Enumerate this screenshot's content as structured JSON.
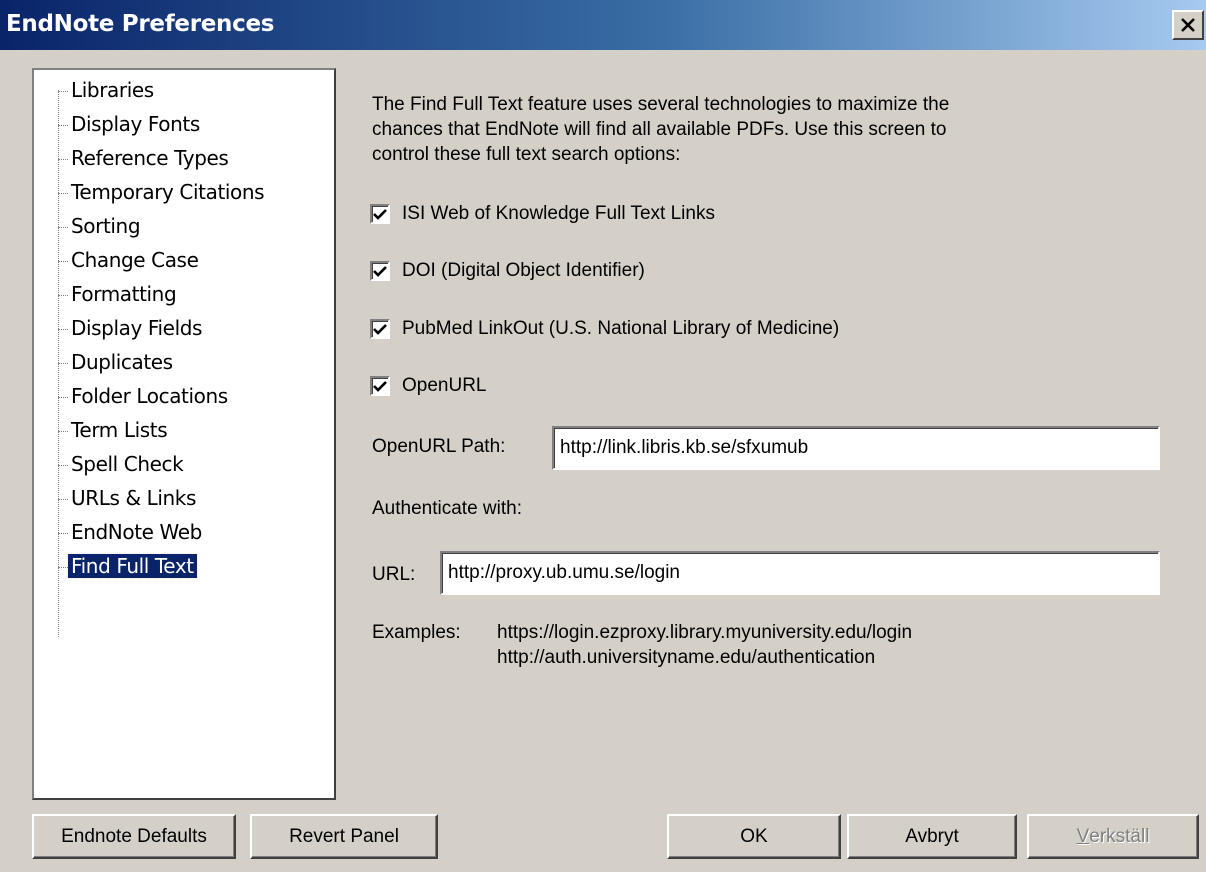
{
  "window": {
    "title": "EndNote Preferences"
  },
  "tree": {
    "items": [
      "Libraries",
      "Display Fonts",
      "Reference Types",
      "Temporary Citations",
      "Sorting",
      "Change Case",
      "Formatting",
      "Display Fields",
      "Duplicates",
      "Folder Locations",
      "Term Lists",
      "Spell Check",
      "URLs & Links",
      "EndNote Web",
      "Find Full Text"
    ],
    "selected": "Find Full Text"
  },
  "panel": {
    "description_line1": "The Find Full Text feature uses several technologies to maximize the",
    "description_line2": "chances that EndNote will find all available PDFs. Use this screen to",
    "description_line3": "control these full text search options:",
    "checkboxes": [
      {
        "label": "ISI Web of Knowledge Full Text Links",
        "checked": true
      },
      {
        "label": "DOI (Digital Object Identifier)",
        "checked": true
      },
      {
        "label": "PubMed LinkOut (U.S. National Library of Medicine)",
        "checked": true
      },
      {
        "label": "OpenURL",
        "checked": true
      }
    ],
    "openurl_path_label": "OpenURL Path:",
    "openurl_path_value": "http://link.libris.kb.se/sfxumub",
    "authenticate_label": "Authenticate with:",
    "url_label": "URL:",
    "url_value": "http://proxy.ub.umu.se/login",
    "examples_label": "Examples:",
    "example_1": "https://login.ezproxy.library.myuniversity.edu/login",
    "example_2": "http://auth.universityname.edu/authentication"
  },
  "buttons": {
    "defaults": "Endnote Defaults",
    "revert": "Revert Panel",
    "ok": "OK",
    "cancel": "Avbryt",
    "apply_mnemonic": "V",
    "apply_rest": "erkställ"
  },
  "icons": {
    "close": "close-icon",
    "check": "checkmark-icon"
  }
}
